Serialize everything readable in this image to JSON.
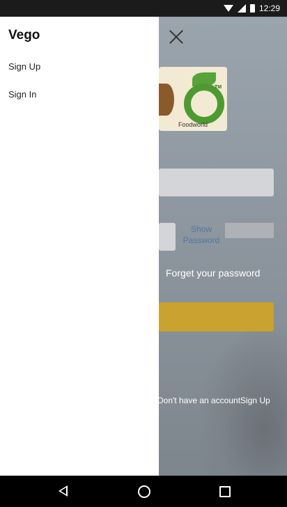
{
  "status_bar": {
    "time": "12:29"
  },
  "drawer": {
    "title": "Vego",
    "items": [
      {
        "label": "Sign Up"
      },
      {
        "label": "Sign In"
      }
    ]
  },
  "login": {
    "logo_text": "Foodworld",
    "logo_tm": "TM",
    "show_password": "Show Password",
    "forget_password": "Forget your password",
    "signup_prompt": "Don't have an accountSign Up"
  },
  "nav_bar": {
    "icons": [
      "back-icon",
      "home-icon",
      "recents-icon"
    ]
  }
}
